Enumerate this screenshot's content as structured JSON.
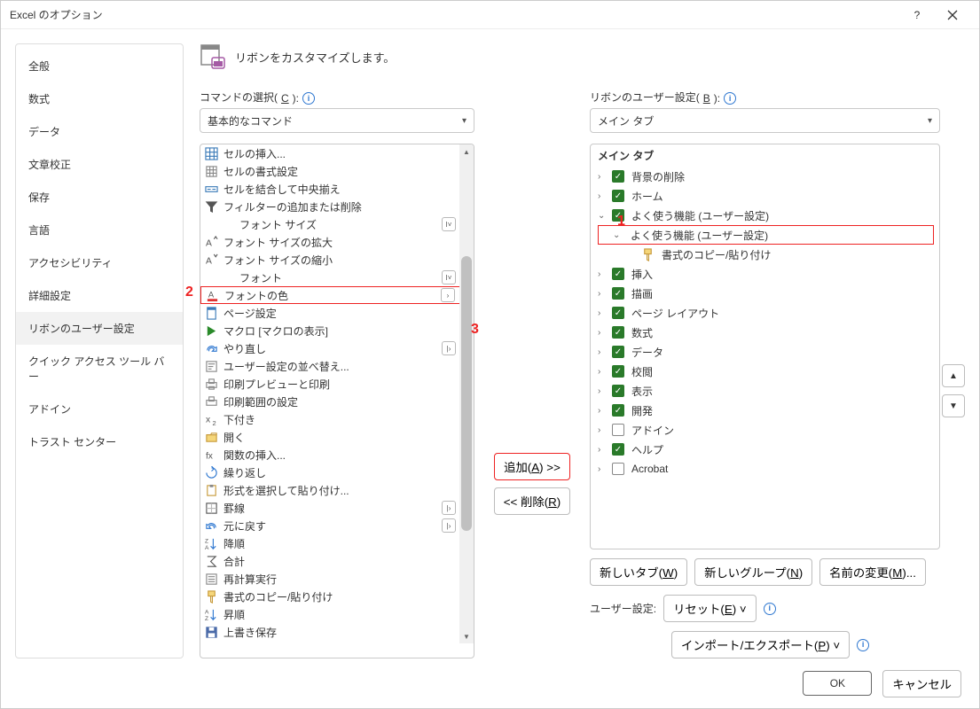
{
  "window": {
    "title": "Excel のオプション"
  },
  "titlebar": {
    "help": "?",
    "close": "×"
  },
  "sidebar": {
    "items": [
      "全般",
      "数式",
      "データ",
      "文章校正",
      "保存",
      "言語",
      "アクセシビリティ",
      "詳細設定",
      "リボンのユーザー設定",
      "クイック アクセス ツール バー",
      "アドイン",
      "トラスト センター"
    ],
    "selected_index": 8
  },
  "header": {
    "text": "リボンをカスタマイズします。"
  },
  "left": {
    "label_prefix": "コマンドの選択(",
    "label_key": "C",
    "label_suffix": "):",
    "combo_value": "基本的なコマンド",
    "commands": [
      {
        "icon": "cell-insert",
        "text": "セルの挿入...",
        "sub": false
      },
      {
        "icon": "cell-format",
        "text": "セルの書式設定",
        "sub": false
      },
      {
        "icon": "merge-center",
        "text": "セルを結合して中央揃え",
        "sub": false
      },
      {
        "icon": "filter",
        "text": "フィルターの追加または削除",
        "sub": false
      },
      {
        "icon": "",
        "text": "フォント サイズ",
        "sub": true,
        "indent": true,
        "subglyph": "I˅"
      },
      {
        "icon": "font-grow",
        "text": "フォント サイズの拡大",
        "sub": false
      },
      {
        "icon": "font-shrink",
        "text": "フォント サイズの縮小",
        "sub": false
      },
      {
        "icon": "",
        "text": "フォント",
        "sub": true,
        "indent": true,
        "subglyph": "I˅"
      },
      {
        "icon": "font-color",
        "text": "フォントの色",
        "sub": true,
        "hl": true,
        "subglyph": "›"
      },
      {
        "icon": "page-setup",
        "text": "ページ設定",
        "sub": false
      },
      {
        "icon": "macro",
        "text": "マクロ [マクロの表示]",
        "sub": false
      },
      {
        "icon": "redo",
        "text": "やり直し",
        "sub": true,
        "subglyph": "|›"
      },
      {
        "icon": "user-sort",
        "text": "ユーザー設定の並べ替え...",
        "sub": false
      },
      {
        "icon": "preview-print",
        "text": "印刷プレビューと印刷",
        "sub": false
      },
      {
        "icon": "print-range",
        "text": "印刷範囲の設定",
        "sub": false
      },
      {
        "icon": "subscript",
        "text": "下付き",
        "sub": false
      },
      {
        "icon": "open",
        "text": "開く",
        "sub": false
      },
      {
        "icon": "fx",
        "text": "関数の挿入...",
        "sub": false
      },
      {
        "icon": "repeat",
        "text": "繰り返し",
        "sub": false
      },
      {
        "icon": "paste-special",
        "text": "形式を選択して貼り付け...",
        "sub": false
      },
      {
        "icon": "borders",
        "text": "罫線",
        "sub": true,
        "subglyph": "|›"
      },
      {
        "icon": "undo",
        "text": "元に戻す",
        "sub": true,
        "subglyph": "|›"
      },
      {
        "icon": "sort-desc",
        "text": "降順",
        "sub": false
      },
      {
        "icon": "sum",
        "text": "合計",
        "sub": false
      },
      {
        "icon": "recalc",
        "text": "再計算実行",
        "sub": false
      },
      {
        "icon": "format-painter",
        "text": "書式のコピー/貼り付け",
        "sub": false
      },
      {
        "icon": "sort-asc",
        "text": "昇順",
        "sub": false
      },
      {
        "icon": "overwrite-save",
        "text": "上書き保存",
        "sub": false
      }
    ]
  },
  "mid": {
    "add_prefix": "追加(",
    "add_key": "A",
    "add_suffix": ") >>",
    "remove_prefix": "<< 削除(",
    "remove_key": "R",
    "remove_suffix": ")"
  },
  "right": {
    "label_prefix": "リボンのユーザー設定(",
    "label_key": "B",
    "label_suffix": "):",
    "combo_value": "メイン タブ",
    "tree_title": "メイン タブ",
    "nodes": [
      {
        "level": 0,
        "disclose": ">",
        "chk": "on",
        "label": "背景の削除"
      },
      {
        "level": 0,
        "disclose": ">",
        "chk": "on",
        "label": "ホーム"
      },
      {
        "level": 0,
        "disclose": "v",
        "chk": "on",
        "label": "よく使う機能 (ユーザー設定)"
      },
      {
        "level": 1,
        "disclose": "v",
        "chk": "",
        "label": "よく使う機能 (ユーザー設定)",
        "hl": true
      },
      {
        "level": 2,
        "disclose": "",
        "chk": "",
        "label": "書式のコピー/貼り付け",
        "icon": "format-painter"
      },
      {
        "level": 0,
        "disclose": ">",
        "chk": "on",
        "label": "挿入"
      },
      {
        "level": 0,
        "disclose": ">",
        "chk": "on",
        "label": "描画"
      },
      {
        "level": 0,
        "disclose": ">",
        "chk": "on",
        "label": "ページ レイアウト"
      },
      {
        "level": 0,
        "disclose": ">",
        "chk": "on",
        "label": "数式"
      },
      {
        "level": 0,
        "disclose": ">",
        "chk": "on",
        "label": "データ"
      },
      {
        "level": 0,
        "disclose": ">",
        "chk": "on",
        "label": "校閲"
      },
      {
        "level": 0,
        "disclose": ">",
        "chk": "on",
        "label": "表示"
      },
      {
        "level": 0,
        "disclose": ">",
        "chk": "on",
        "label": "開発"
      },
      {
        "level": 0,
        "disclose": ">",
        "chk": "off",
        "label": "アドイン"
      },
      {
        "level": 0,
        "disclose": ">",
        "chk": "on",
        "label": "ヘルプ"
      },
      {
        "level": 0,
        "disclose": ">",
        "chk": "off",
        "label": "Acrobat"
      }
    ],
    "new_tab": {
      "prefix": "新しいタブ(",
      "key": "W",
      "suffix": ")"
    },
    "new_group": {
      "prefix": "新しいグループ(",
      "key": "N",
      "suffix": ")"
    },
    "rename": {
      "prefix": "名前の変更(",
      "key": "M",
      "suffix": ")..."
    },
    "userset_label": "ユーザー設定:",
    "reset": {
      "prefix": "リセット(",
      "key": "E",
      "suffix": ") ˅"
    },
    "impexp": {
      "prefix": "インポート/エクスポート(",
      "key": "P",
      "suffix": ") ˅"
    }
  },
  "footer": {
    "ok": "OK",
    "cancel": "キャンセル"
  },
  "annotations": {
    "a1": "1",
    "a2": "2",
    "a3": "3"
  },
  "colors": {
    "accent_red": "#e22222",
    "check_green": "#2a7a2a",
    "info_blue": "#2e77d0"
  }
}
